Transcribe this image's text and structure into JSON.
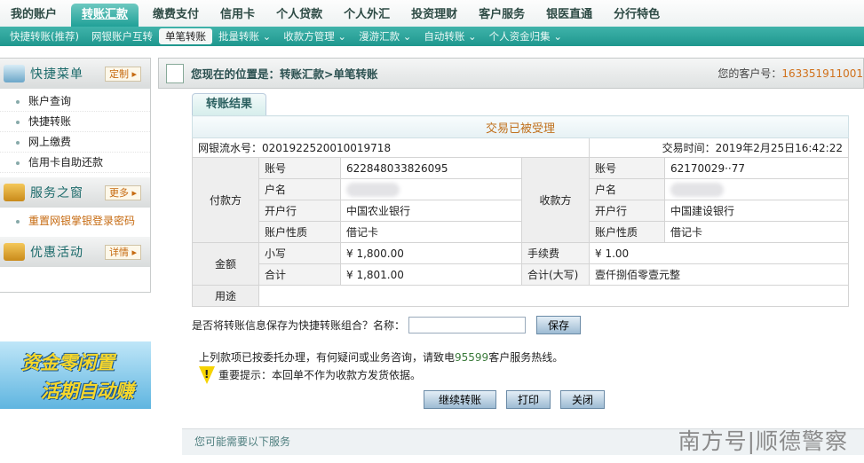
{
  "top_nav": [
    "我的账户",
    "转账汇款",
    "缴费支付",
    "信用卡",
    "个人贷款",
    "个人外汇",
    "投资理财",
    "客户服务",
    "银医直通",
    "分行特色"
  ],
  "top_nav_active": 1,
  "sub_nav": [
    "快捷转账(推荐)",
    "网银账户互转",
    "单笔转账",
    "批量转账 ⌄",
    "收款方管理 ⌄",
    "漫游汇款 ⌄",
    "自动转账 ⌄",
    "个人资金归集 ⌄"
  ],
  "sub_nav_active": 2,
  "sidebar": {
    "quick": {
      "title": "快捷菜单",
      "btn": "定制 ▸",
      "items": [
        "账户查询",
        "快捷转账",
        "网上缴费",
        "信用卡自助还款"
      ]
    },
    "service": {
      "title": "服务之窗",
      "btn": "更多 ▸",
      "items": [
        "重置网银掌银登录密码"
      ]
    },
    "promo": {
      "title": "优惠活动",
      "btn": "详情 ▸"
    },
    "banner": {
      "line1": "资金零闲置",
      "line2": "活期自动赚"
    }
  },
  "header": {
    "location": "您现在的位置是：转账汇款>单笔转账",
    "customer_label": "您的客户号：",
    "customer_no": "163351911001"
  },
  "result": {
    "tab": "转账结果",
    "status": "交易已被受理",
    "serial_label": "网银流水号：",
    "serial": "0201922520010019718",
    "time_label": "交易时间：",
    "time": "2019年2月25日16:42:22",
    "payer": {
      "group": "付款方",
      "account_label": "账号",
      "account": "622848033826095",
      "name_label": "户名",
      "bank_label": "开户行",
      "bank": "中国农业银行",
      "type_label": "账户性质",
      "type": "借记卡"
    },
    "payee": {
      "group": "收款方",
      "account_label": "账号",
      "account": "62170029··77",
      "name_label": "户名",
      "bank_label": "开户行",
      "bank": "中国建设银行",
      "type_label": "账户性质",
      "type": "借记卡"
    },
    "amount": {
      "group": "金额",
      "small_label": "小写",
      "small": "¥ 1,800.00",
      "fee_label": "手续费",
      "fee": "¥ 1.00",
      "total_label": "合计",
      "total": "¥ 1,801.00",
      "total_cn_label": "合计(大写)",
      "total_cn": "壹仟捌佰零壹元整"
    },
    "purpose_label": "用途"
  },
  "save": {
    "question": "是否将转账信息保存为快捷转账组合？名称：",
    "value": "",
    "button": "保存"
  },
  "notes": {
    "line1a": "上列款项已按委托办理，有何疑问或业务咨询，请致电",
    "phone": "95599",
    "line1b": "客户服务热线。",
    "warn": "重要提示：本回单不作为收款方发货依据。"
  },
  "buttons": {
    "continue": "继续转账",
    "print": "打印",
    "close": "关闭"
  },
  "services": "您可能需要以下服务",
  "watermark": "南方号|顺德警察"
}
